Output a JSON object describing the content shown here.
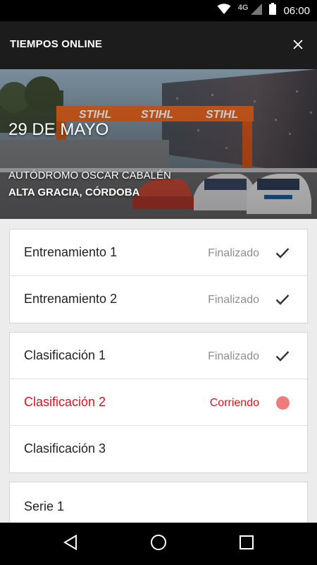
{
  "status_bar": {
    "network": "4G",
    "time": "06:00"
  },
  "app_bar": {
    "title": "TIEMPOS ONLINE",
    "close_icon": "close-icon"
  },
  "event": {
    "date": "29 DE MAYO",
    "venue": "AUTÓDROMO OSCAR CABALÉN",
    "city": "ALTA GRACIA, CÓRDOBA",
    "banner_brand": "STIHL"
  },
  "sessions": [
    {
      "name": "Entrenamiento 1",
      "status": "Finalizado",
      "indicator": "check-icon"
    },
    {
      "name": "Entrenamiento 2",
      "status": "Finalizado",
      "indicator": "check-icon"
    },
    {
      "name": "Clasificación 1",
      "status": "Finalizado",
      "indicator": "check-icon"
    },
    {
      "name": "Clasificación 2",
      "status": "Corriendo",
      "indicator": "live-dot-icon"
    },
    {
      "name": "Clasificación 3",
      "status": "",
      "indicator": ""
    },
    {
      "name": "Serie 1",
      "status": "",
      "indicator": ""
    }
  ],
  "colors": {
    "active": "#e2101a",
    "live_dot": "#f17b7b",
    "appbar": "#1c1c1c"
  },
  "nav": {
    "back": "back-icon",
    "home": "home-icon",
    "recents": "recents-icon"
  }
}
